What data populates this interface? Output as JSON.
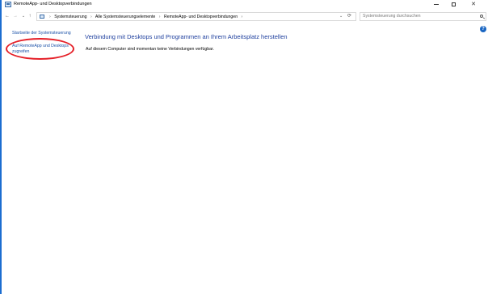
{
  "window": {
    "title": "RemoteApp- und Desktopverbindungen",
    "icon": "control-panel-icon",
    "controls": {
      "minimize": "minimize-icon",
      "maximize": "maximize-icon",
      "close": "✕"
    }
  },
  "nav": {
    "back": "←",
    "forward": "→",
    "recent": "⌄",
    "up": "↑"
  },
  "address": {
    "breadcrumbs": [
      "Systemsteuerung",
      "Alle Systemsteuerungselemente",
      "RemoteApp- und Desktopverbindungen"
    ],
    "separator": "›",
    "dropdown": "⌄",
    "refresh": "⟳"
  },
  "search": {
    "placeholder": "Systemsteuerung durchsuchen",
    "value": ""
  },
  "help": {
    "label": "?"
  },
  "left_pane": {
    "home_link": "Startseite der Systemsteuerung",
    "access_link": "Auf RemoteApp und Desktops zugreifen"
  },
  "main": {
    "heading": "Verbindung mit Desktops und Programmen an Ihrem Arbeitsplatz herstellen",
    "status": "Auf diesem Computer sind momentan keine Verbindungen verfügbar."
  },
  "colors": {
    "link": "#1c52a8",
    "heading": "#1e3f9e",
    "highlight": "#e52028",
    "border_accent": "#1c6dd0"
  }
}
